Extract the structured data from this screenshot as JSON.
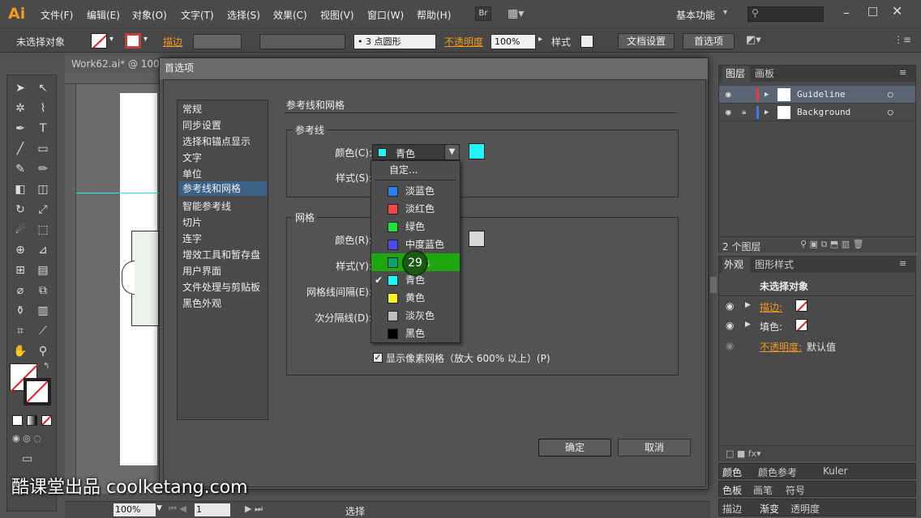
{
  "menubar": {
    "logo": "Ai",
    "items": [
      "文件(F)",
      "编辑(E)",
      "对象(O)",
      "文字(T)",
      "选择(S)",
      "效果(C)",
      "视图(V)",
      "窗口(W)",
      "帮助(H)"
    ],
    "bridge": "Br",
    "workspace": "基本功能",
    "search_placeholder": ""
  },
  "controlbar": {
    "selection": "未选择对象",
    "stroke_label": "描边",
    "brush": "3 点圆形",
    "opacity_label": "不透明度",
    "opacity_value": "100%",
    "style_label": "样式",
    "doc_setup": "文档设置",
    "prefs": "首选项"
  },
  "document": {
    "tab": "Work62.ai* @ 100"
  },
  "dialog": {
    "title": "首选项",
    "categories": [
      "常规",
      "同步设置",
      "选择和锚点显示",
      "文字",
      "单位",
      "参考线和网格",
      "智能参考线",
      "切片",
      "连字",
      "增效工具和暂存盘",
      "用户界面",
      "文件处理与剪贴板",
      "黑色外观"
    ],
    "selected_category": "参考线和网格",
    "section_title": "参考线和网格",
    "guides": {
      "group": "参考线",
      "color_label": "颜色(C):",
      "color_value": "青色",
      "style_label": "样式(S):"
    },
    "grid": {
      "group": "网格",
      "color_label": "颜色(R):",
      "style_label": "样式(Y):",
      "spacing_label": "网格线间隔(E):",
      "subdiv_label": "次分隔线(D):"
    },
    "pixel_grid": "显示像素网格（放大 600% 以上）(P)",
    "ok": "确定",
    "cancel": "取消"
  },
  "dropdown": {
    "custom": "自定...",
    "options": [
      {
        "label": "淡蓝色",
        "color": "#2f7de8"
      },
      {
        "label": "淡红色",
        "color": "#f04a4a"
      },
      {
        "label": "绿色",
        "color": "#22e03a"
      },
      {
        "label": "中度蓝色",
        "color": "#4a4af0"
      },
      {
        "label": "色",
        "color": "#11a06a"
      },
      {
        "label": "青色",
        "color": "#22f5f5"
      },
      {
        "label": "黄色",
        "color": "#f5f02a"
      },
      {
        "label": "淡灰色",
        "color": "#bdbdbd"
      },
      {
        "label": "黑色",
        "color": "#000000"
      }
    ],
    "cursor_number": "29"
  },
  "layers_panel": {
    "tabs": [
      "图层",
      "画板"
    ],
    "layers": [
      {
        "name": "Guideline",
        "color": "#e04040"
      },
      {
        "name": "Background",
        "color": "#3a7de0"
      }
    ],
    "count": "2 个图层"
  },
  "appearance_panel": {
    "tabs": [
      "外观",
      "图形样式"
    ],
    "title": "未选择对象",
    "stroke": "描边:",
    "fill": "填色:",
    "opacity": "不透明度:",
    "opacity_value": "默认值"
  },
  "bottom_panels": {
    "row1": [
      "颜色",
      "颜色参考",
      "Kuler"
    ],
    "row2": [
      "色板",
      "画笔",
      "符号"
    ],
    "row3": [
      "描边",
      "渐变",
      "透明度"
    ]
  },
  "statusbar": {
    "zoom": "100%",
    "page": "1",
    "mode": "选择"
  },
  "watermark": "酷课堂出品 coolketang.com"
}
